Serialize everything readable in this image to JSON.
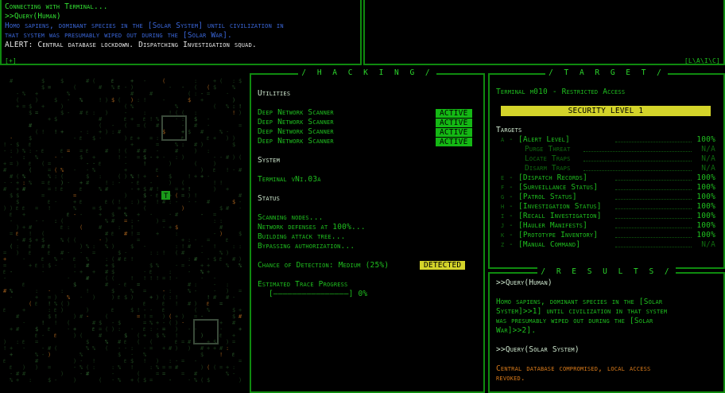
{
  "log": {
    "lines": [
      {
        "text": "Connecting with Terminal...",
        "cls": "bright"
      },
      {
        "text": ">>Query(Human)",
        "cls": "bright"
      },
      {
        "text": "Homo sapiens, dominant species in the [Solar System] until civilization in",
        "cls": "blue"
      },
      {
        "text": "  that system was presumably wiped out during the [Solar War].",
        "cls": "blue"
      },
      {
        "text": "ALERT: Central database lockdown. Dispatching Investigation squad.",
        "cls": "white"
      }
    ],
    "corner_left": "[+]",
    "corner_right": "[L\\A\\I\\C]"
  },
  "hacking": {
    "title": "/ H A C K I N G /",
    "utilities_heading": "Utilities",
    "utilities": [
      {
        "name": "Deep Network Scanner",
        "status": "ACTIVE"
      },
      {
        "name": "Deep Network Scanner",
        "status": "ACTIVE"
      },
      {
        "name": "Deep Network Scanner",
        "status": "ACTIVE"
      },
      {
        "name": "Deep Network Scanner",
        "status": "ACTIVE"
      }
    ],
    "system_heading": "System",
    "system_name": "Terminal vNi.03a",
    "status_heading": "Status",
    "status_lines": [
      "Scanning nodes...",
      "Network defenses at 100%...",
      "Building attack tree...",
      "Bypassing authorization..."
    ],
    "detection_label": "Chance of Detection: Medium (25%)",
    "detection_badge": "DETECTED",
    "trace_label": "Estimated Trace Progress",
    "trace_bar": "[————————————————]",
    "trace_value": "0%",
    "trace_fraction": 0.0
  },
  "target": {
    "title": "/ T A R G E T /",
    "terminal_name": "Terminal m010 - Restricted Access",
    "security_level": "SECURITY LEVEL 1",
    "targets_heading": "Targets",
    "rows": [
      {
        "key": "a",
        "label": "[Alert Level]",
        "value": "100%",
        "sub": false
      },
      {
        "key": "",
        "label": "Purge Threat",
        "value": "N/A",
        "sub": true
      },
      {
        "key": "",
        "label": "Locate Traps",
        "value": "N/A",
        "sub": true
      },
      {
        "key": "",
        "label": "Disarm Traps",
        "value": "N/A",
        "sub": true
      },
      {
        "key": "e",
        "label": "[Dispatch Records]",
        "value": "100%",
        "sub": false
      },
      {
        "key": "f",
        "label": "[Surveillance Status]",
        "value": "100%",
        "sub": false
      },
      {
        "key": "g",
        "label": "[Patrol Status]",
        "value": "100%",
        "sub": false
      },
      {
        "key": "h",
        "label": "[Investigation Status]",
        "value": "100%",
        "sub": false
      },
      {
        "key": "i",
        "label": "[Recall Investigation]",
        "value": "100%",
        "sub": false
      },
      {
        "key": "j",
        "label": "[Hauler Manifests]",
        "value": "100%",
        "sub": false
      },
      {
        "key": "k",
        "label": "[Prototype Inventory]",
        "value": "100%",
        "sub": false
      },
      {
        "key": "z",
        "label": "[Manual Command]",
        "value": "N/A",
        "sub": false
      }
    ]
  },
  "results": {
    "title": "/ R E S U L T S /",
    "query1": ">>Query(Human)",
    "answer1_lines": [
      "Homo sapiens, dominant species in the [Solar",
      "System]>>1] until civilization in that system",
      "was presumably wiped out during the [Solar",
      "War]>>2]."
    ],
    "query2": ">>Query(Solar System)",
    "answer2_lines": [
      "Central database compromised, local access",
      "revoked."
    ]
  },
  "map": {
    "player_glyph": "T"
  },
  "colors": {
    "accent": "#1fbf1f",
    "border": "#0f8a0f",
    "active": "#14b814",
    "alert_yellow": "#d4d42a",
    "blue_text": "#3a66d8",
    "orange_text": "#d87a1a"
  }
}
